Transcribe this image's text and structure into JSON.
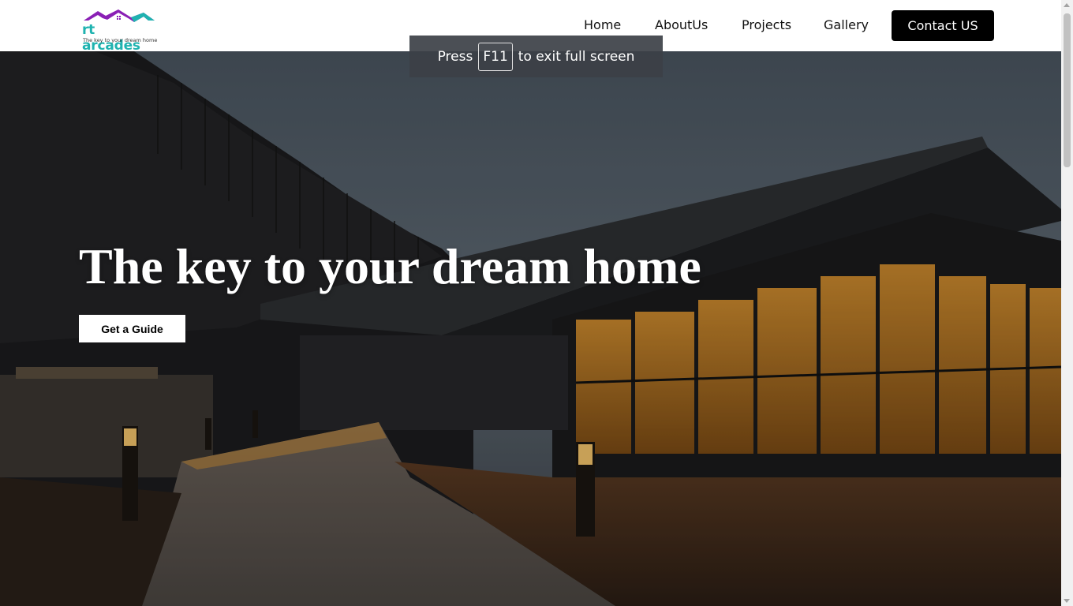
{
  "header": {
    "logo_text": "rt arcades",
    "logo_tagline": "The key to your dream home",
    "nav": {
      "home": "Home",
      "about": "AboutUs",
      "projects": "Projects",
      "gallery": "Gallery",
      "contact": "Contact US"
    }
  },
  "hero": {
    "title": "The key to your dream home",
    "cta": "Get a Guide"
  },
  "fullscreen_toast": {
    "prefix": "Press",
    "key": "F11",
    "suffix": "to exit full screen"
  },
  "colors": {
    "logo_roof": "#8a1fb5",
    "logo_text": "#1fb3b0",
    "contact_bg": "#000000"
  }
}
